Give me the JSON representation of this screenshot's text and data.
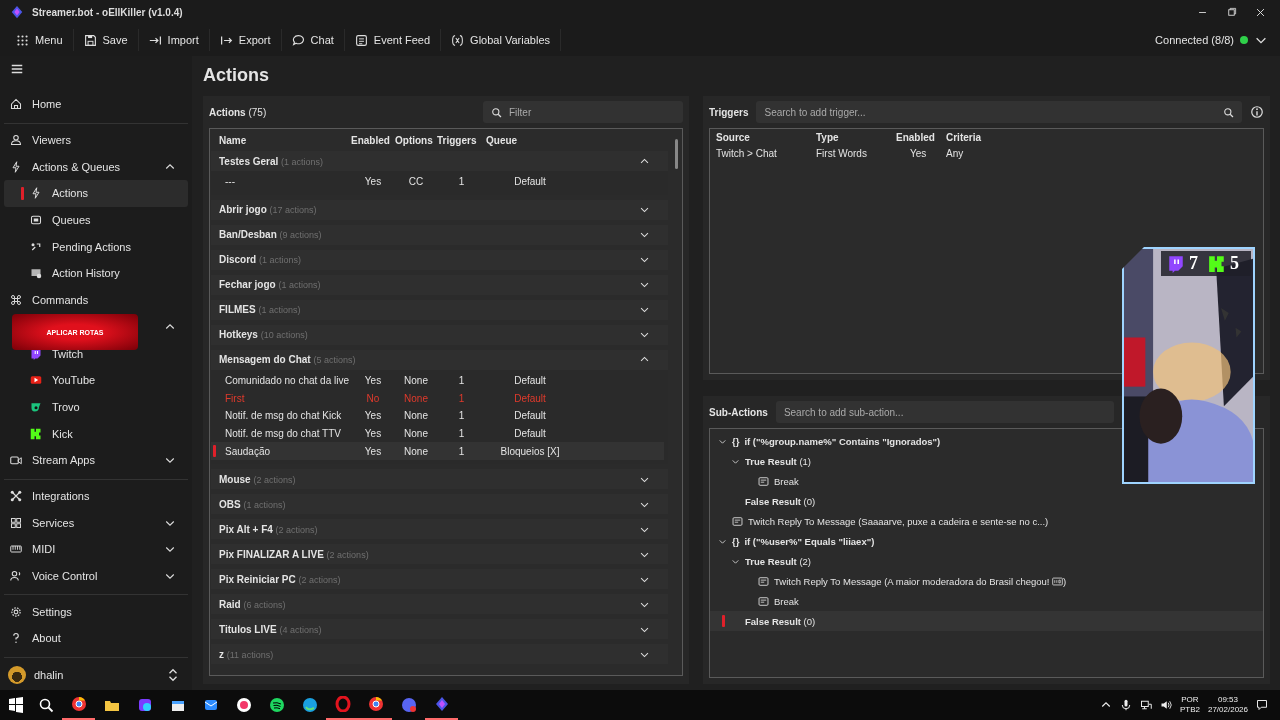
{
  "window": {
    "title": "Streamer.bot - oEllKiller (v1.0.4)"
  },
  "toolbar": [
    {
      "label": "Menu"
    },
    {
      "label": "Save"
    },
    {
      "label": "Import"
    },
    {
      "label": "Export"
    },
    {
      "label": "Chat"
    },
    {
      "label": "Event Feed"
    },
    {
      "label": "Global Variables"
    }
  ],
  "connection": {
    "label": "Connected (8/8)",
    "connected": true
  },
  "sidebar": {
    "sections": [
      [
        {
          "label": "Home",
          "selected": false
        }
      ],
      [
        {
          "label": "Viewers",
          "selected": false
        },
        {
          "label": "Actions & Queues",
          "selected": false,
          "expanded": true,
          "children": [
            {
              "label": "Actions",
              "selected": true
            },
            {
              "label": "Queues",
              "selected": false
            },
            {
              "label": "Pending Actions",
              "selected": false
            },
            {
              "label": "Action History",
              "selected": false
            }
          ]
        },
        {
          "label": "Commands",
          "selected": false
        },
        {
          "selected": false,
          "expanded": true,
          "children": [
            {
              "label": "Twitch",
              "selected": false
            },
            {
              "label": "YouTube",
              "selected": false
            },
            {
              "label": "Trovo",
              "selected": false
            },
            {
              "label": "Kick",
              "selected": false
            }
          ]
        },
        {
          "label": "Stream Apps",
          "selected": false,
          "expanded": false
        }
      ],
      [
        {
          "label": "Integrations",
          "selected": false
        },
        {
          "label": "Services",
          "selected": false,
          "expanded": false
        },
        {
          "label": "MIDI",
          "selected": false,
          "expanded": false
        },
        {
          "label": "Voice Control",
          "selected": false,
          "expanded": false
        }
      ],
      [
        {
          "label": "Settings",
          "selected": false
        },
        {
          "label": "About",
          "selected": false
        }
      ]
    ],
    "user": {
      "name": "dhalin"
    }
  },
  "page_title": "Actions",
  "actions": {
    "title": "Actions",
    "count": "(75)",
    "filter_placeholder": "Filter",
    "columns": [
      "Name",
      "Enabled",
      "Options",
      "Triggers",
      "Queue"
    ],
    "groups": [
      {
        "name": "Testes Geral",
        "count": "(1 actions)",
        "expanded": true,
        "actions": [
          {
            "name": "---",
            "enabled": "Yes",
            "options": "CC",
            "triggers": "1",
            "queue": "Default",
            "disabled": false,
            "selected": false
          }
        ]
      },
      {
        "name": "Abrir jogo",
        "count": "(17 actions)",
        "expanded": false
      },
      {
        "name": "Ban/Desban",
        "count": "(9 actions)",
        "expanded": false
      },
      {
        "name": "Discord",
        "count": "(1 actions)",
        "expanded": false
      },
      {
        "name": "Fechar jogo",
        "count": "(1 actions)",
        "expanded": false
      },
      {
        "name": "FILMES",
        "count": "(1 actions)",
        "expanded": false
      },
      {
        "name": "Hotkeys",
        "count": "(10 actions)",
        "expanded": false
      },
      {
        "name": "Mensagem do Chat",
        "count": "(5 actions)",
        "expanded": true,
        "actions": [
          {
            "name": "Comunidado no chat da live",
            "enabled": "Yes",
            "options": "None",
            "triggers": "1",
            "queue": "Default",
            "disabled": false,
            "selected": false
          },
          {
            "name": "First",
            "enabled": "No",
            "options": "None",
            "triggers": "1",
            "queue": "Default",
            "disabled": true,
            "selected": false
          },
          {
            "name": "Notif. de msg do chat Kick",
            "enabled": "Yes",
            "options": "None",
            "triggers": "1",
            "queue": "Default",
            "disabled": false,
            "selected": false
          },
          {
            "name": "Notif. de msg do chat TTV",
            "enabled": "Yes",
            "options": "None",
            "triggers": "1",
            "queue": "Default",
            "disabled": false,
            "selected": false
          },
          {
            "name": "Saudação",
            "enabled": "Yes",
            "options": "None",
            "triggers": "1",
            "queue": "Bloqueios [X]",
            "disabled": false,
            "selected": true
          }
        ]
      },
      {
        "name": "Mouse",
        "count": "(2 actions)",
        "expanded": false
      },
      {
        "name": "OBS",
        "count": "(1 actions)",
        "expanded": false
      },
      {
        "name": "Pix Alt + F4",
        "count": "(2 actions)",
        "expanded": false
      },
      {
        "name": "Pix FINALIZAR A LIVE",
        "count": "(2 actions)",
        "expanded": false
      },
      {
        "name": "Pix Reiniciar PC",
        "count": "(2 actions)",
        "expanded": false
      },
      {
        "name": "Raid",
        "count": "(6 actions)",
        "expanded": false
      },
      {
        "name": "Titulos LIVE",
        "count": "(4 actions)",
        "expanded": false
      },
      {
        "name": "z",
        "count": "(11 actions)",
        "expanded": false
      }
    ]
  },
  "triggers": {
    "title": "Triggers",
    "placeholder": "Search to add trigger...",
    "columns": [
      "Source",
      "Type",
      "Enabled",
      "Criteria"
    ],
    "rows": [
      {
        "source": "Twitch > Chat",
        "type": "First Words",
        "enabled": "Yes",
        "criteria": "Any"
      }
    ]
  },
  "sub_actions": {
    "title": "Sub-Actions",
    "placeholder": "Search to add sub-action...",
    "tree": [
      {
        "kind": "if",
        "glyph": "{}",
        "text": "if (\"%group.name%\" Contains \"Ignorados\")",
        "expanded": true,
        "selected": false,
        "children": [
          {
            "kind": "result",
            "text": "True Result",
            "count": "(1)",
            "expanded": true,
            "selected": false,
            "children": [
              {
                "kind": "action",
                "text": "Break",
                "selected": false
              }
            ]
          },
          {
            "kind": "result",
            "text": "False Result",
            "count": "(0)",
            "selected": false
          }
        ]
      },
      {
        "kind": "action",
        "text": "Twitch Reply To Message (Saaaarve, puxe a cadeira e sente-se no c...)",
        "selected": false
      },
      {
        "kind": "if",
        "glyph": "{}",
        "text": "if (\"%user%\" Equals \"liiaex\")",
        "expanded": true,
        "selected": false,
        "children": [
          {
            "kind": "result",
            "text": "True Result",
            "count": "(2)",
            "expanded": true,
            "selected": false,
            "children": [
              {
                "kind": "action",
                "text": "Twitch Reply To Message (A maior moderadora do Brasil chegou!",
                "emote": true,
                "text_after": ")",
                "selected": false
              },
              {
                "kind": "action",
                "text": "Break",
                "selected": false
              }
            ]
          },
          {
            "kind": "result",
            "text": "False Result",
            "count": "(0)",
            "selected": true
          }
        ]
      }
    ]
  },
  "banner": {
    "text": "APLICAR ROTAS"
  },
  "stream_overlay": {
    "kind": "picture",
    "twitch_count": "7",
    "kick_count": "5"
  },
  "taskbar": {
    "apps": [
      {
        "running": true
      },
      {
        "running": false
      },
      {
        "running": false
      },
      {
        "running": false
      },
      {
        "running": false
      },
      {
        "running": false
      },
      {
        "running": false
      },
      {
        "running": false
      },
      {
        "running": true
      },
      {
        "running": true
      },
      {
        "running": false
      },
      {
        "running": true
      }
    ],
    "language": "POR",
    "layout": "PTB2",
    "time": "09:53",
    "date": "27/02/2026"
  }
}
